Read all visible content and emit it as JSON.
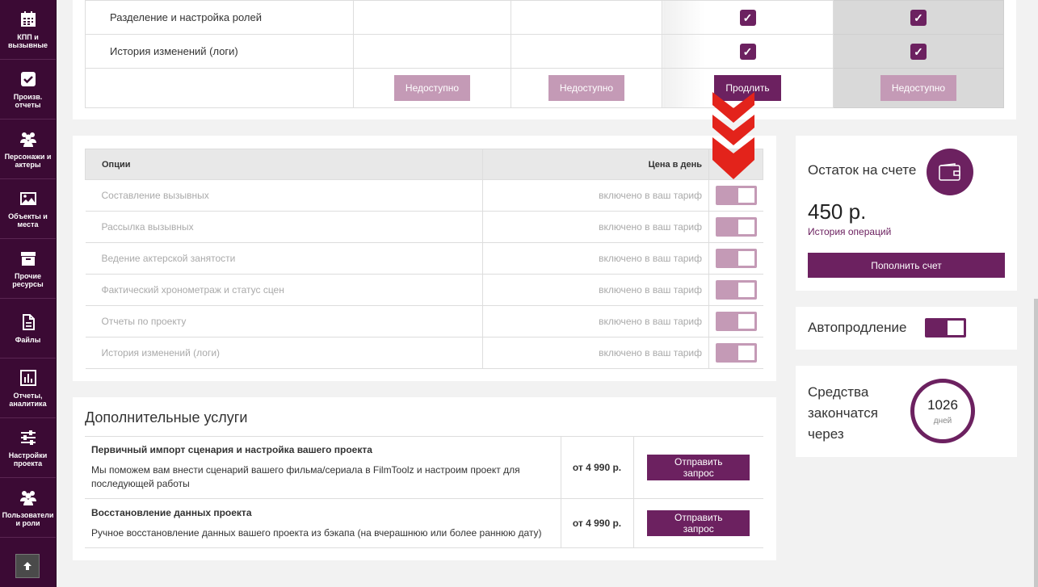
{
  "sidebar": {
    "items": [
      {
        "label": "КПП и вызывные",
        "icon": "calendar-icon"
      },
      {
        "label": "Произв. отчеты",
        "icon": "checkbox-icon"
      },
      {
        "label": "Персонажи и актеры",
        "icon": "people-icon"
      },
      {
        "label": "Объекты и места",
        "icon": "image-icon"
      },
      {
        "label": "Прочие ресурсы",
        "icon": "box-icon"
      },
      {
        "label": "Файлы",
        "icon": "file-icon"
      },
      {
        "label": "Отчеты, аналитика",
        "icon": "bar-chart-icon"
      },
      {
        "label": "Настройки проекта",
        "icon": "sliders-icon"
      },
      {
        "label": "Пользователи и роли",
        "icon": "users-icon"
      }
    ],
    "scroll_up_icon": "arrow-up-icon"
  },
  "plans_table": {
    "rows": [
      {
        "label": "Разделение и настройка ролей"
      },
      {
        "label": "История изменений (логи)"
      }
    ],
    "actions": [
      "Недоступно",
      "Недоступно",
      "Продлить",
      "Недоступно"
    ]
  },
  "options": {
    "header": {
      "name": "Опции",
      "price": "Цена в день"
    },
    "rows": [
      {
        "name": "Составление вызывных",
        "price": "включено в ваш тариф",
        "enabled": true
      },
      {
        "name": "Рассылка вызывных",
        "price": "включено в ваш тариф",
        "enabled": true
      },
      {
        "name": "Ведение актерской занятости",
        "price": "включено в ваш тариф",
        "enabled": true
      },
      {
        "name": "Фактический хронометраж и статус сцен",
        "price": "включено в ваш тариф",
        "enabled": true
      },
      {
        "name": "Отчеты по проекту",
        "price": "включено в ваш тариф",
        "enabled": true
      },
      {
        "name": "История изменений (логи)",
        "price": "включено в ваш тариф",
        "enabled": true
      }
    ]
  },
  "services": {
    "title": "Дополнительные услуги",
    "rows": [
      {
        "name": "Первичный импорт сценария и настройка вашего проекта",
        "desc": "Мы поможем вам внести сценарий вашего фильма/сериала в FilmToolz и настроим проект для последующей работы",
        "price": "от 4 990 р.",
        "button": "Отправить запрос"
      },
      {
        "name": "Восстановление данных проекта",
        "desc": "Ручное восстановление данных вашего проекта из бэкапа (на вчерашнюю или более раннюю дату)",
        "price": "от 4 990 р.",
        "button": "Отправить запрос"
      }
    ]
  },
  "balance": {
    "title": "Остаток на счете",
    "amount": "450 р.",
    "history_link": "История операций",
    "topup_button": "Пополнить счет",
    "icon": "wallet-icon"
  },
  "autorenew": {
    "label": "Автопродление",
    "enabled": true
  },
  "funds": {
    "label": "Средства закончатся через",
    "days": "1026",
    "unit": "дней"
  },
  "colors": {
    "accent": "#6c2160",
    "accent_muted": "#c49ab6",
    "sidebar": "#3b0a34",
    "arrow": "#e3231b"
  }
}
